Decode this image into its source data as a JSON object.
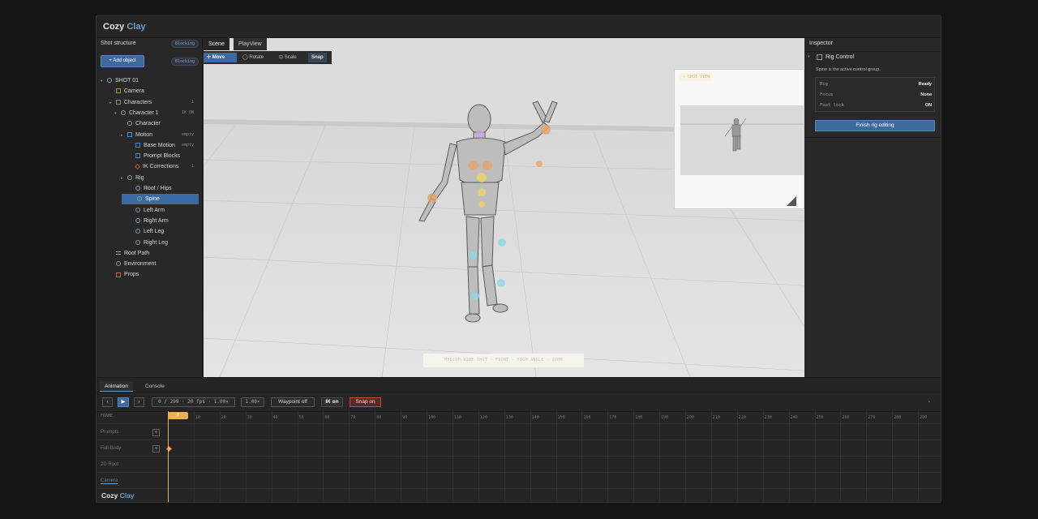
{
  "app": {
    "name_a": "Cozy",
    "name_b": "Clay"
  },
  "left": {
    "title": "Shot structure",
    "badge1": "Blocking",
    "add_label": "+ Add object",
    "badge2": "Blocking",
    "tree": [
      {
        "label": "SHOT 01",
        "icon": "c",
        "depth": 0,
        "caret": "▾",
        "meta": ""
      },
      {
        "label": "Camera",
        "icon": "sq-orange",
        "depth": 1,
        "caret": "",
        "meta": ""
      },
      {
        "label": "Characters",
        "icon": "sq-gray",
        "depth": 1,
        "caret": "▸",
        "meta": "1"
      },
      {
        "label": "Character 1",
        "icon": "c",
        "depth": 2,
        "caret": "▾",
        "meta": "IK ON"
      },
      {
        "label": "Character",
        "icon": "c",
        "depth": 3,
        "caret": "",
        "meta": ""
      },
      {
        "label": "Motion",
        "icon": "sq-blue",
        "depth": 3,
        "caret": "▸",
        "meta": "empty"
      },
      {
        "label": "Base Motion",
        "icon": "sq-blue",
        "depth": 4,
        "caret": "",
        "meta": "empty"
      },
      {
        "label": "Prompt Blocks",
        "icon": "sq-blue",
        "depth": 4,
        "caret": "",
        "meta": ""
      },
      {
        "label": "IK Corrections",
        "icon": "dia",
        "depth": 4,
        "caret": "",
        "meta": "1"
      },
      {
        "label": "Rig",
        "icon": "c",
        "depth": 3,
        "caret": "▸",
        "meta": ""
      },
      {
        "label": "Root / Hips",
        "icon": "c",
        "depth": 4,
        "caret": "",
        "meta": ""
      },
      {
        "label": "Spine",
        "icon": "c",
        "depth": 4,
        "caret": "",
        "meta": "",
        "selected": true
      },
      {
        "label": "Left Arm",
        "icon": "c",
        "depth": 4,
        "caret": "",
        "meta": ""
      },
      {
        "label": "Right Arm",
        "icon": "c",
        "depth": 4,
        "caret": "",
        "meta": ""
      },
      {
        "label": "Left Leg",
        "icon": "c",
        "depth": 4,
        "caret": "",
        "meta": ""
      },
      {
        "label": "Right Leg",
        "icon": "c",
        "depth": 4,
        "caret": "",
        "meta": ""
      },
      {
        "label": "Root Path",
        "icon": "line",
        "depth": 1,
        "caret": "",
        "meta": ""
      },
      {
        "label": "Environment",
        "icon": "c",
        "depth": 1,
        "caret": "",
        "meta": ""
      },
      {
        "label": "Props",
        "icon": "sq-red",
        "depth": 1,
        "caret": "",
        "meta": ""
      }
    ]
  },
  "viewport": {
    "tab_scene": "Scene",
    "tab_playview": "PlayView",
    "tools": {
      "move": "Move",
      "rotate": "Rotate",
      "scale": "Scale",
      "snap": "Snap"
    },
    "shot_view_label": "› SHOT VIEW",
    "caption": "MEDIUM-WIDE SHOT · FRONT · HIGH ANGLE · 28MM"
  },
  "inspector": {
    "title": "Inspector",
    "section": "Rig Control",
    "desc": "Spine is the active control group.",
    "rows": [
      {
        "k": "Rig",
        "v": "Ready"
      },
      {
        "k": "Focus",
        "v": "None"
      },
      {
        "k": "Foot lock",
        "v": "ON"
      }
    ],
    "finish": "Finish rig editing"
  },
  "bottom": {
    "tab_animation": "Animation",
    "tab_console": "Console",
    "prev": "‹",
    "play": "▶",
    "next": "›",
    "frame_info": "0 / 299 · 20 fps · 1.00×",
    "speed": "1.00×",
    "waypoint": "Waypoint off",
    "ik": "IK on",
    "snap": "Snap on",
    "frame_label": "FRAME",
    "playhead": "0",
    "tracks": [
      "Prompts",
      "Full-Body",
      "2D Root",
      "Camera"
    ],
    "ticks": [
      "10",
      "20",
      "30",
      "40",
      "50",
      "60",
      "70",
      "80",
      "90",
      "100",
      "110",
      "120",
      "130",
      "140",
      "150",
      "160",
      "170",
      "180",
      "190",
      "200",
      "210",
      "220",
      "230",
      "240",
      "250",
      "260",
      "270",
      "280",
      "290"
    ]
  },
  "colors": {
    "accent": "#3d6a9e",
    "playhead": "#e6b254",
    "snap_on": "#c0503f"
  }
}
